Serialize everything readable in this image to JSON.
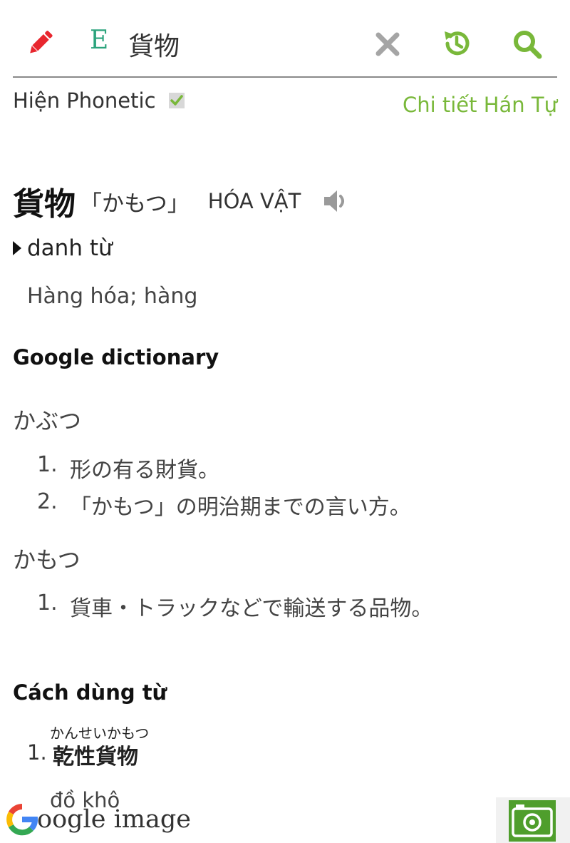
{
  "search": {
    "lang_label": "E",
    "query": "貨物"
  },
  "options": {
    "phonetic_label": "Hiện Phonetic",
    "phonetic_checked": true,
    "kanji_detail_link": "Chi tiết Hán Tự"
  },
  "entry": {
    "word": "貨物",
    "reading": "「かもつ」",
    "hanviet": "HÓA VẬT",
    "part_of_speech": "danh từ",
    "meaning": "Hàng hóa; hàng"
  },
  "google_dictionary": {
    "title": "Google dictionary",
    "groups": [
      {
        "word": "かぶつ",
        "definitions": [
          {
            "num": "1.",
            "text": "形の有る財貨。"
          },
          {
            "num": "2.",
            "text": "「かもつ」の明治期までの言い方。"
          }
        ]
      },
      {
        "word": "かもつ",
        "definitions": [
          {
            "num": "1.",
            "text": "貨車・トラックなどで輸送する品物。"
          }
        ]
      }
    ]
  },
  "usage": {
    "title": "Cách dùng từ",
    "items": [
      {
        "num": "1.",
        "ruby": "かんせいかもつ",
        "kanji": "乾性貨物",
        "meaning": "đồ khô"
      }
    ]
  },
  "bottom": {
    "google_image_label": "oogle image"
  },
  "colors": {
    "accent_green": "#79b83a",
    "teal": "#2ba37c",
    "pencil_red": "#e8262e",
    "icon_gray": "#a5a5a5"
  },
  "icons": [
    "pencil-icon",
    "close-icon",
    "history-icon",
    "search-icon",
    "checkmark-icon",
    "speaker-icon",
    "google-g-icon",
    "camera-icon"
  ]
}
